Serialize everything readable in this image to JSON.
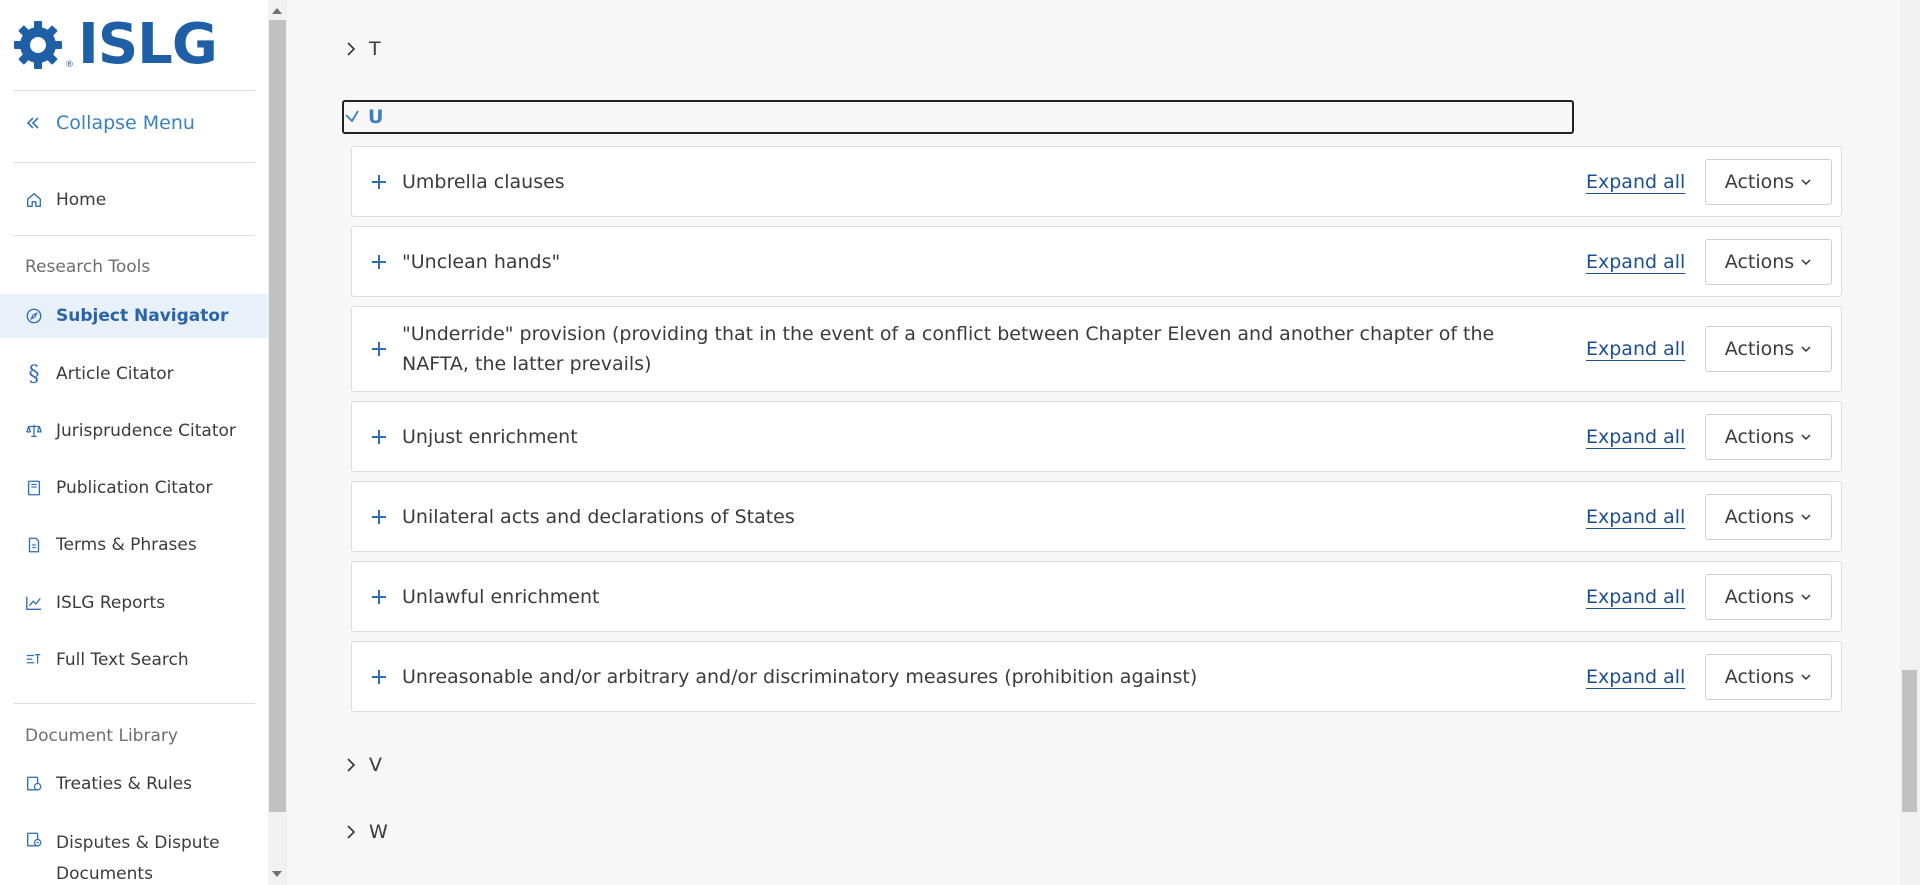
{
  "brand": {
    "logo_text": "ISLG",
    "logo_mark": "®"
  },
  "sidebar": {
    "collapse_label": "Collapse Menu",
    "home_label": "Home",
    "research_tools_heading": "Research Tools",
    "research_items": [
      {
        "label": "Subject Navigator",
        "icon": "compass-icon",
        "active": true
      },
      {
        "label": "Article Citator",
        "icon": "section-sign-icon",
        "active": false
      },
      {
        "label": "Jurisprudence Citator",
        "icon": "scales-icon",
        "active": false
      },
      {
        "label": "Publication Citator",
        "icon": "book-icon",
        "active": false
      },
      {
        "label": "Terms & Phrases",
        "icon": "document-icon",
        "active": false
      },
      {
        "label": "ISLG Reports",
        "icon": "chart-line-icon",
        "active": false
      },
      {
        "label": "Full Text Search",
        "icon": "text-search-icon",
        "active": false
      }
    ],
    "document_library_heading": "Document Library",
    "library_items": [
      {
        "label": "Treaties & Rules",
        "icon": "treaty-icon"
      },
      {
        "label": "Disputes & Dispute Documents",
        "icon": "dispute-icon"
      }
    ]
  },
  "letters": {
    "t": "T",
    "u": "U",
    "v": "V",
    "w": "W"
  },
  "subjects": [
    {
      "title": "Umbrella clauses",
      "expand": "Expand all",
      "actions": "Actions"
    },
    {
      "title": "\"Unclean hands\"",
      "expand": "Expand all",
      "actions": "Actions"
    },
    {
      "title": "\"Underride\" provision (providing that in the event of a conflict between Chapter Eleven and another chapter of the NAFTA, the latter prevails)",
      "expand": "Expand all",
      "actions": "Actions"
    },
    {
      "title": "Unjust enrichment",
      "expand": "Expand all",
      "actions": "Actions"
    },
    {
      "title": "Unilateral acts and declarations of States",
      "expand": "Expand all",
      "actions": "Actions"
    },
    {
      "title": "Unlawful enrichment",
      "expand": "Expand all",
      "actions": "Actions"
    },
    {
      "title": "Unreasonable and/or arbitrary and/or discriminatory measures (prohibition against)",
      "expand": "Expand all",
      "actions": "Actions"
    }
  ],
  "colors": {
    "brand_blue": "#1f5fa6",
    "link_blue": "#1c4f93",
    "accent_blue": "#3a7fc2",
    "active_bg": "#e8f1f9"
  }
}
